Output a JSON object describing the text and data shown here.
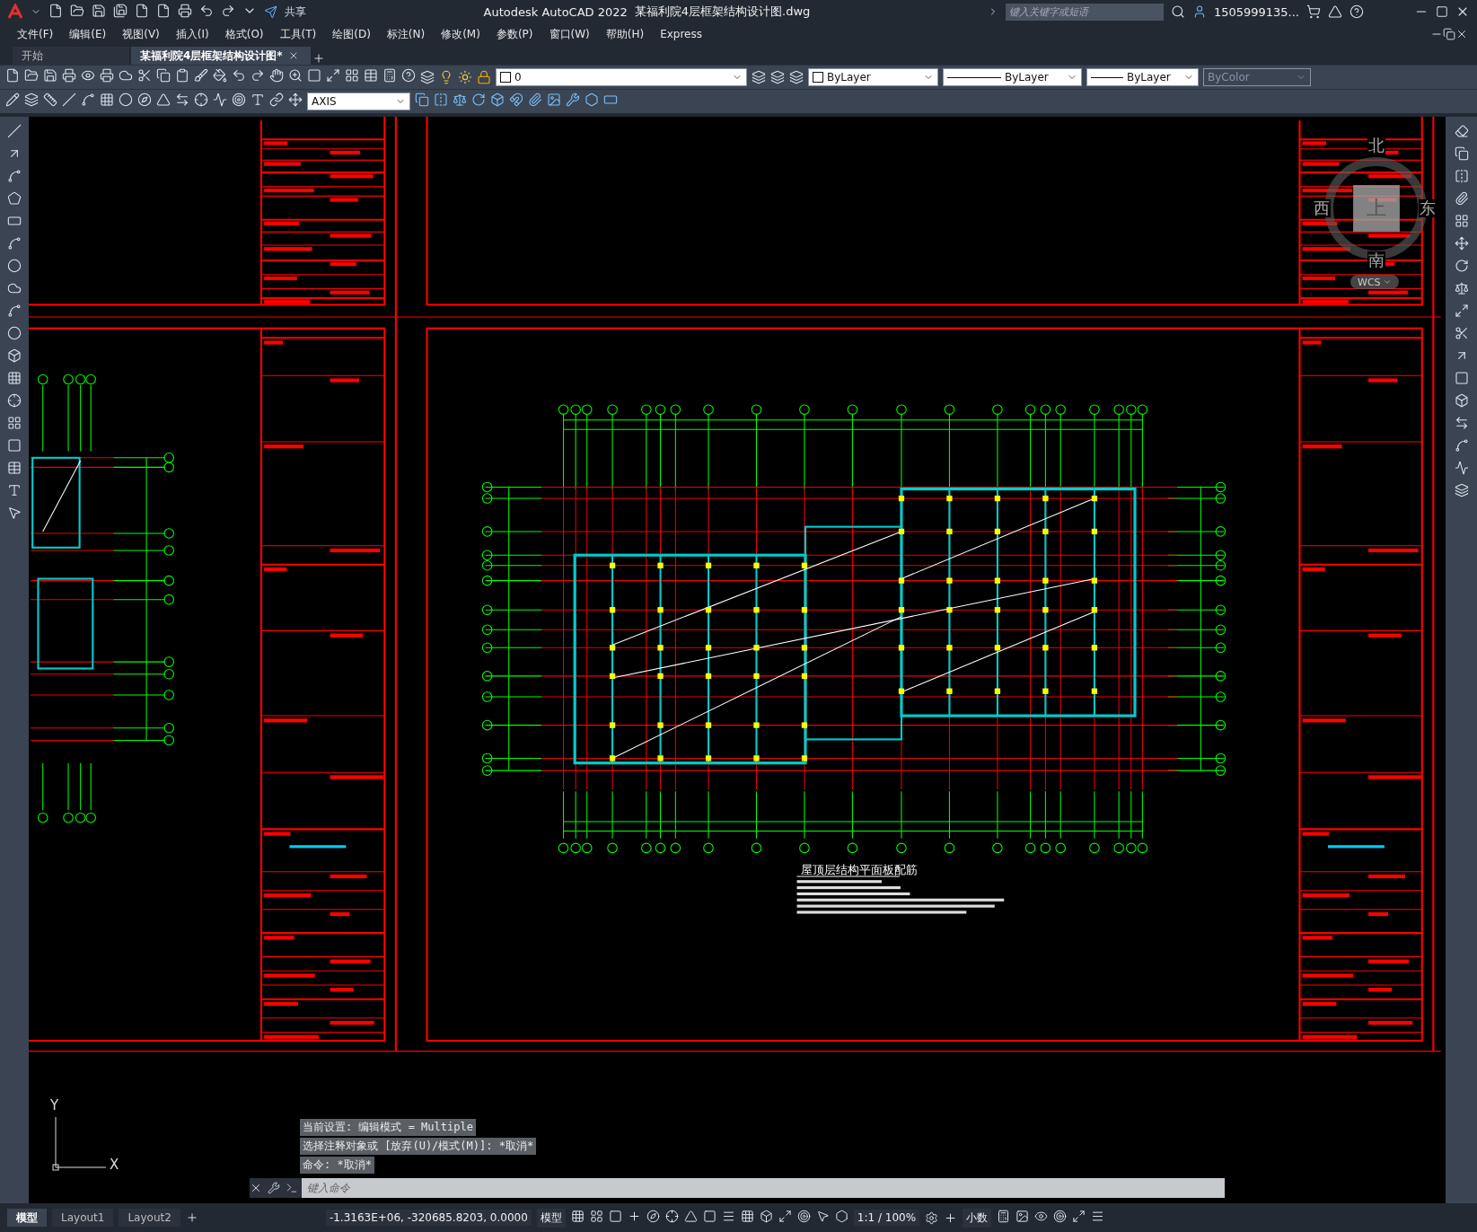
{
  "title_bar": {
    "app_title": "Autodesk AutoCAD 2022",
    "file_name": "某福利院4层框架结构设计图.dwg",
    "share": "共享",
    "search_placeholder": "键入关键字或短语",
    "user": "1505999135..."
  },
  "menu": [
    "文件(F)",
    "编辑(E)",
    "视图(V)",
    "插入(I)",
    "格式(O)",
    "工具(T)",
    "绘图(D)",
    "标注(N)",
    "修改(M)",
    "参数(P)",
    "窗口(W)",
    "帮助(H)",
    "Express"
  ],
  "doc_tabs": [
    {
      "label": "开始",
      "selected": false
    },
    {
      "label": "某福利院4层框架结构设计图*",
      "selected": true
    }
  ],
  "properties": {
    "layer": "0",
    "color_control": "ByLayer",
    "linetype": "ByLayer",
    "lineweight": "ByLayer",
    "plot_style": "ByColor",
    "plot_style_disabled": true,
    "dim_style": "AXIS"
  },
  "drawing": {
    "plan_title": "屋顶层结构平面板配筋"
  },
  "viewcube": {
    "north": "北",
    "west": "西",
    "east": "东",
    "south": "南",
    "top": "上",
    "coord_system": "WCS"
  },
  "ucs": {
    "y": "Y",
    "x": "X"
  },
  "command_history": [
    "当前设置: 编辑模式 = Multiple",
    "选择注释对象或 [放弃(U)/模式(M)]: *取消*",
    "命令: *取消*"
  ],
  "command_placeholder": "键入命令",
  "layout_tabs": [
    {
      "label": "模型",
      "selected": true
    },
    {
      "label": "Layout1",
      "selected": false
    },
    {
      "label": "Layout2",
      "selected": false
    }
  ],
  "status_bar": {
    "coordinates": "-1.3163E+06, -320685.8203, 0.0000",
    "space": "模型",
    "scale": "1:1 / 100%",
    "units": "小数"
  }
}
